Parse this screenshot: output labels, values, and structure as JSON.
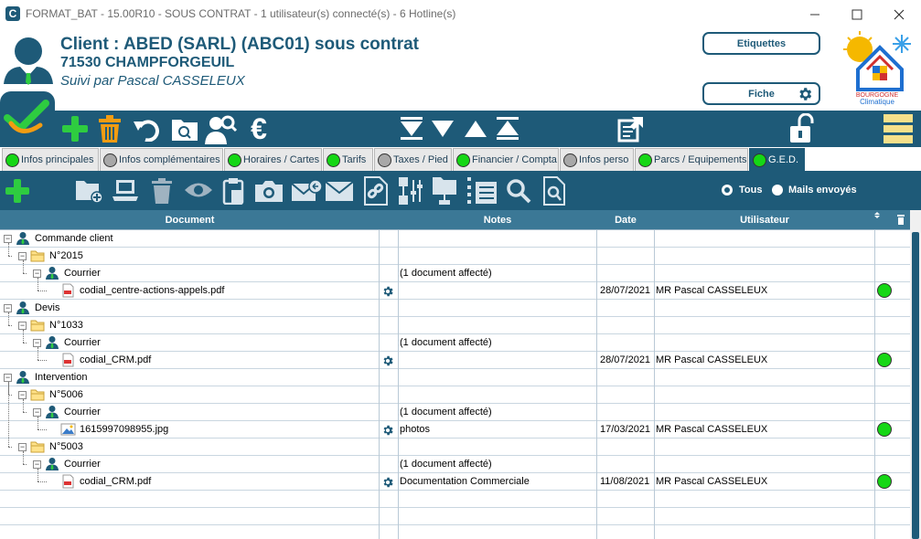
{
  "window": {
    "title": "FORMAT_BAT - 15.00R10 - SOUS CONTRAT - 1 utilisateur(s) connecté(s) - 6 Hotline(s)",
    "app_icon": "C"
  },
  "client": {
    "title": "Client : ABED (SARL) (ABC01)  sous contrat",
    "city": "71530 CHAMPFORGEUIL",
    "suivi": "Suivi par Pascal CASSELEUX"
  },
  "header_buttons": {
    "etiquettes": "Etiquettes",
    "fiche": "Fiche"
  },
  "logo": {
    "line1": "BOURGOGNE",
    "line2": "Climatique"
  },
  "toolbar_icons": [
    "validate-icon",
    "add-icon",
    "trash-icon",
    "undo-icon",
    "folder-search-icon",
    "user-search-icon",
    "euro-icon",
    "first-icon",
    "down-icon",
    "up-icon",
    "last-icon",
    "export-icon",
    "unlock-icon",
    "menu-icon"
  ],
  "tabs": [
    {
      "label": "Infos principales",
      "status": "green"
    },
    {
      "label": "Infos complémentaires",
      "status": "grey"
    },
    {
      "label": "Horaires / Cartes",
      "status": "green"
    },
    {
      "label": "Tarifs",
      "status": "green"
    },
    {
      "label": "Taxes / Pied",
      "status": "grey"
    },
    {
      "label": "Financier / Compta",
      "status": "green"
    },
    {
      "label": "Infos perso",
      "status": "grey"
    },
    {
      "label": "Parcs / Equipements",
      "status": "green"
    },
    {
      "label": "G.E.D.",
      "status": "green",
      "active": true
    }
  ],
  "ged_toolbar": {
    "icons": [
      "add-icon",
      "add-folder-icon",
      "computer-icon",
      "trash-icon",
      "view-icon",
      "clipboard-icon",
      "camera-icon",
      "mail-reply-icon",
      "mail-icon",
      "link-document-icon",
      "settings-tree-icon",
      "network-folder-icon",
      "list-icon",
      "search-icon",
      "search-document-icon"
    ],
    "radio_all": "Tous",
    "radio_mails": "Mails envoyés",
    "radio_selected": "Tous"
  },
  "grid": {
    "columns": {
      "document": "Document",
      "notes": "Notes",
      "date": "Date",
      "user": "Utilisateur"
    },
    "rows": [
      {
        "level": 0,
        "type": "person",
        "label": "Commande client",
        "notes": "",
        "date": "",
        "user": "",
        "action": false,
        "status": false
      },
      {
        "level": 1,
        "type": "folder",
        "label": "N°2015",
        "notes": "",
        "date": "",
        "user": "",
        "action": false,
        "status": false
      },
      {
        "level": 2,
        "type": "person",
        "label": "Courrier",
        "notes": "(1 document affecté)",
        "date": "",
        "user": "",
        "action": false,
        "status": false
      },
      {
        "level": 3,
        "type": "pdf",
        "label": "codial_centre-actions-appels.pdf",
        "notes": "",
        "date": "28/07/2021",
        "user": "MR Pascal CASSELEUX",
        "action": true,
        "status": true
      },
      {
        "level": 0,
        "type": "person",
        "label": "Devis",
        "notes": "",
        "date": "",
        "user": "",
        "action": false,
        "status": false
      },
      {
        "level": 1,
        "type": "folder",
        "label": "N°1033",
        "notes": "",
        "date": "",
        "user": "",
        "action": false,
        "status": false
      },
      {
        "level": 2,
        "type": "person",
        "label": "Courrier",
        "notes": "(1 document affecté)",
        "date": "",
        "user": "",
        "action": false,
        "status": false
      },
      {
        "level": 3,
        "type": "pdf",
        "label": "codial_CRM.pdf",
        "notes": "",
        "date": "28/07/2021",
        "user": "MR Pascal CASSELEUX",
        "action": true,
        "status": true
      },
      {
        "level": 0,
        "type": "person",
        "label": "Intervention",
        "notes": "",
        "date": "",
        "user": "",
        "action": false,
        "status": false
      },
      {
        "level": 1,
        "type": "folder",
        "label": "N°5006",
        "notes": "",
        "date": "",
        "user": "",
        "action": false,
        "status": false
      },
      {
        "level": 2,
        "type": "person",
        "label": "Courrier",
        "notes": "(1 document affecté)",
        "date": "",
        "user": "",
        "action": false,
        "status": false
      },
      {
        "level": 3,
        "type": "image",
        "label": "1615997098955.jpg",
        "notes": "photos",
        "date": "17/03/2021",
        "user": "MR Pascal CASSELEUX",
        "action": true,
        "status": true
      },
      {
        "level": 1,
        "type": "folder",
        "label": "N°5003",
        "notes": "",
        "date": "",
        "user": "",
        "action": false,
        "status": false
      },
      {
        "level": 2,
        "type": "person",
        "label": "Courrier",
        "notes": "(1 document affecté)",
        "date": "",
        "user": "",
        "action": false,
        "status": false
      },
      {
        "level": 3,
        "type": "pdf",
        "label": "codial_CRM.pdf",
        "notes": "Documentation Commerciale",
        "date": "11/08/2021",
        "user": "MR Pascal CASSELEUX",
        "action": true,
        "status": true
      }
    ]
  },
  "colors": {
    "primary": "#1e5a78",
    "accent_green": "#2ecc40",
    "accent_orange": "#f39c12",
    "status_green": "#15d715"
  }
}
